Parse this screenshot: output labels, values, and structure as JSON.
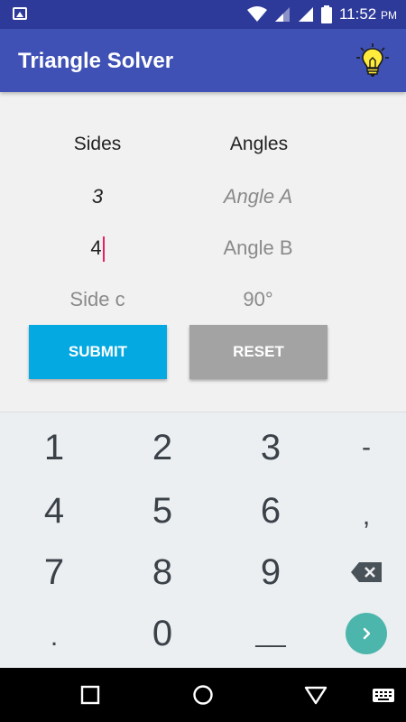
{
  "status_bar": {
    "time": "11:52",
    "ampm": "PM"
  },
  "app_bar": {
    "title": "Triangle Solver"
  },
  "form": {
    "sides_header": "Sides",
    "angles_header": "Angles",
    "side_a_value": "3",
    "side_b_value": "4",
    "side_c_placeholder": "Side c",
    "angle_a_placeholder": "Angle A",
    "angle_b_placeholder": "Angle B",
    "angle_c_value": "90°",
    "submit_label": "SUBMIT",
    "reset_label": "RESET"
  },
  "keyboard": {
    "keys": [
      "1",
      "2",
      "3",
      "-",
      "4",
      "5",
      "6",
      ",",
      "7",
      "8",
      "9",
      ".",
      "0",
      "__"
    ]
  },
  "colors": {
    "app_bar": "#3f51b5",
    "status_bar": "#2e3a9a",
    "submit": "#03a9e0",
    "reset": "#a3a3a3",
    "cursor": "#e91e63",
    "go_key": "#4db6ac",
    "bulb": "#ffeb3b"
  }
}
